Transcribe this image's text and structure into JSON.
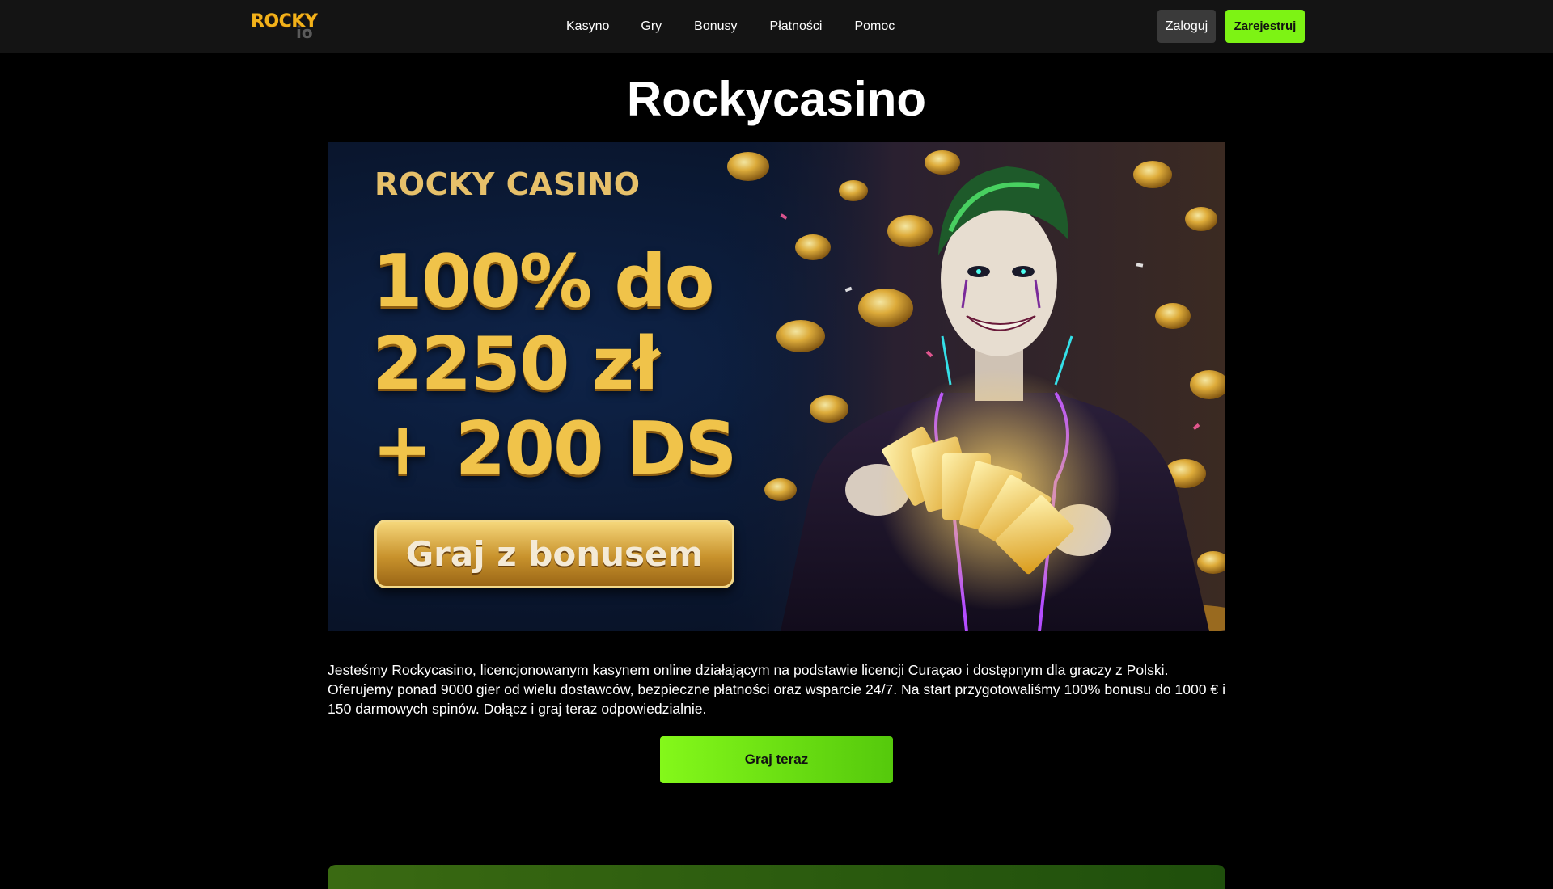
{
  "header": {
    "logo_text": "ROCKY",
    "logo_suffix": "io",
    "nav": [
      "Kasyno",
      "Gry",
      "Bonusy",
      "Płatności",
      "Pomoc"
    ],
    "login_label": "Zaloguj",
    "register_label": "Zarejestruj"
  },
  "main": {
    "title": "Rockycasino",
    "banner": {
      "brand": "ROCKY CASINO",
      "offer_line1": "100% do",
      "offer_line2": "2250 zł",
      "offer_line3": "+ 200 DS",
      "cta": "Graj z bonusem"
    },
    "description": "Jesteśmy Rockycasino, licencjonowanym kasynem online działającym na podstawie licencji Curaçao i dostępnym dla graczy z Polski. Oferujemy ponad 9000 gier od wielu dostawców, bezpieczne płatności oraz wsparcie 24/7. Na start przygotowaliśmy 100% bonusu do 1000 € i 150 darmowych spinów. Dołącz i graj teraz odpowiedzialnie.",
    "play_button": "Graj teraz"
  },
  "colors": {
    "accent_green": "#7df314",
    "header_bg": "#141414",
    "page_bg": "#000000",
    "gold": "#f0c34a"
  }
}
